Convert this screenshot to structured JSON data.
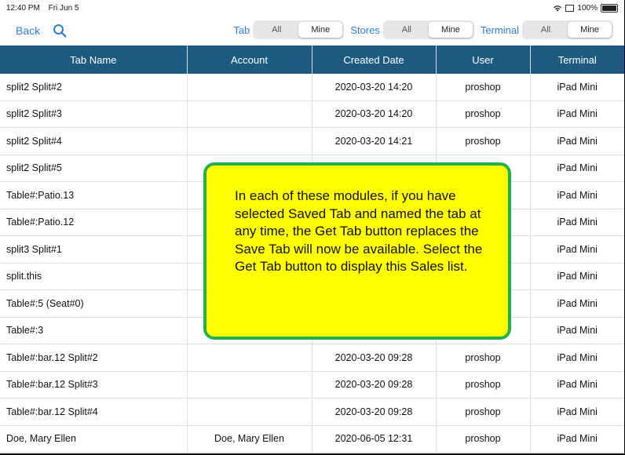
{
  "status": {
    "time": "12:40 PM",
    "date": "Fri Jun 5",
    "battery": "100%"
  },
  "nav": {
    "back": "Back",
    "tab_label": "Tab",
    "tab_options": [
      "All",
      "Mine"
    ],
    "stores_label": "Stores",
    "stores_options": [
      "All",
      "Mine"
    ],
    "terminal_label": "Terminal",
    "terminal_options": [
      "All",
      "Mine"
    ],
    "selected": {
      "tab": "Mine",
      "stores": "Mine",
      "terminal": "Mine"
    }
  },
  "table": {
    "headers": [
      "Tab Name",
      "Account",
      "Created Date",
      "User",
      "Terminal"
    ],
    "rows": [
      [
        "split2 Split#2",
        "",
        "2020-03-20  14:20",
        "proshop",
        "iPad Mini"
      ],
      [
        "split2 Split#3",
        "",
        "2020-03-20  14:20",
        "proshop",
        "iPad Mini"
      ],
      [
        "split2 Split#4",
        "",
        "2020-03-20  14:21",
        "proshop",
        "iPad Mini"
      ],
      [
        "split2 Split#5",
        "",
        "",
        "",
        "iPad Mini"
      ],
      [
        "Table#:Patio.13",
        "",
        "",
        "",
        "iPad Mini"
      ],
      [
        "Table#:Patio.12",
        "",
        "",
        "",
        "iPad Mini"
      ],
      [
        "split3 Split#1",
        "",
        "",
        "",
        "iPad Mini"
      ],
      [
        "split.this",
        "",
        "",
        "",
        "iPad Mini"
      ],
      [
        "Table#:5 (Seat#0)",
        "",
        "",
        "",
        "iPad Mini"
      ],
      [
        "Table#:3",
        "",
        "",
        "",
        "iPad Mini"
      ],
      [
        "Table#:bar.12 Split#2",
        "",
        "2020-03-20  09:28",
        "proshop",
        "iPad Mini"
      ],
      [
        "Table#:bar.12 Split#3",
        "",
        "2020-03-20  09:28",
        "proshop",
        "iPad Mini"
      ],
      [
        "Table#:bar.12 Split#4",
        "",
        "2020-03-20  09:28",
        "proshop",
        "iPad Mini"
      ],
      [
        "Doe, Mary Ellen",
        "Doe, Mary Ellen",
        "2020-06-05  12:31",
        "proshop",
        "iPad Mini"
      ]
    ]
  },
  "callout": {
    "text": "In each of these modules, if you have selected Saved Tab and named the tab at any time, the Get Tab button replaces the Save Tab will now be available. Select the Get Tab button to display this Sales list."
  },
  "colors": {
    "accent": "#2b7de1",
    "header_bg": "#1e5a80",
    "callout_bg": "#ffff00",
    "callout_border": "#22b24c"
  },
  "icons": [
    "search-icon",
    "wifi-icon",
    "battery-icon"
  ]
}
